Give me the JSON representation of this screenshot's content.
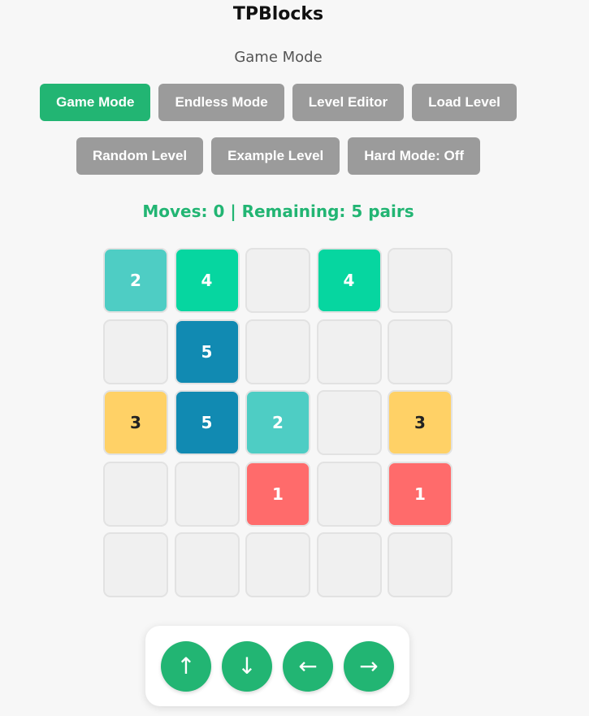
{
  "title": "TPBlocks",
  "mode_label": "Game Mode",
  "buttons_row1": [
    {
      "name": "game-mode-button",
      "label": "Game Mode",
      "active": true
    },
    {
      "name": "endless-mode-button",
      "label": "Endless Mode",
      "active": false
    },
    {
      "name": "level-editor-button",
      "label": "Level Editor",
      "active": false
    },
    {
      "name": "load-level-button",
      "label": "Load Level",
      "active": false
    }
  ],
  "buttons_row2": [
    {
      "name": "random-level-button",
      "label": "Random Level",
      "active": false
    },
    {
      "name": "example-level-button",
      "label": "Example Level",
      "active": false
    },
    {
      "name": "hard-mode-toggle",
      "label": "Hard Mode: Off",
      "active": false
    }
  ],
  "status": "Moves: 0 | Remaining: 5 pairs",
  "board": [
    [
      "2",
      "4",
      "",
      "4",
      ""
    ],
    [
      "",
      "5",
      "",
      "",
      ""
    ],
    [
      "3",
      "5",
      "2",
      "",
      "3"
    ],
    [
      "",
      "",
      "1",
      "",
      "1"
    ],
    [
      "",
      "",
      "",
      "",
      ""
    ]
  ],
  "tile_colors": {
    "1": "#ff6b6b",
    "2": "#4ecdc4",
    "3": "#ffd166",
    "4": "#06d6a0",
    "5": "#118ab2",
    "empty": "#f0f0f0"
  },
  "accent_color": "#22b573",
  "arrow_buttons": [
    {
      "name": "move-up-button",
      "glyph": "↑"
    },
    {
      "name": "move-down-button",
      "glyph": "↓"
    },
    {
      "name": "move-left-button",
      "glyph": "←"
    },
    {
      "name": "move-right-button",
      "glyph": "→"
    }
  ]
}
